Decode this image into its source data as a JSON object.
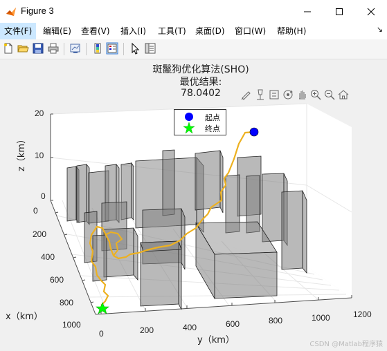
{
  "window": {
    "title": "Figure 3"
  },
  "menu": [
    {
      "label": "文件(F)"
    },
    {
      "label": "编辑(E)"
    },
    {
      "label": "查看(V)"
    },
    {
      "label": "插入(I)"
    },
    {
      "label": "工具(T)"
    },
    {
      "label": "桌面(D)"
    },
    {
      "label": "窗口(W)"
    },
    {
      "label": "帮助(H)"
    }
  ],
  "toolbar": {
    "icons": [
      "new-figure-icon",
      "open-file-icon",
      "save-icon",
      "print-icon",
      "link-plot-icon",
      "colorbar-icon",
      "legend-icon",
      "pointer-icon",
      "property-inspector-icon"
    ]
  },
  "axes_toolbar": {
    "icons": [
      "brush-icon",
      "data-tips-icon",
      "insert-colorbar-icon",
      "rotate-3d-icon",
      "pan-icon",
      "zoom-in-icon",
      "zoom-out-icon",
      "home-icon"
    ]
  },
  "figure": {
    "title_line1": "斑鬣狗优化算法(SHO)",
    "title_line2": "最优结果:",
    "title_line3": "78.0402",
    "legend": [
      {
        "label": "起点",
        "color": "#0000ff",
        "marker": "circle"
      },
      {
        "label": "终点",
        "color": "#00ff00",
        "marker": "star"
      }
    ],
    "xlabel": "x（km）",
    "ylabel": "y（km）",
    "zlabel": "z（km）",
    "x_ticks": [
      "0",
      "200",
      "400",
      "600",
      "800",
      "1000"
    ],
    "y_ticks": [
      "0",
      "200",
      "400",
      "600",
      "800",
      "1000",
      "1200"
    ],
    "z_ticks": [
      "0",
      "10",
      "20"
    ],
    "path_color": "#edb120",
    "box_color": "#808080"
  },
  "chart_data": {
    "type": "3d-line",
    "title": "斑鬣狗优化算法(SHO) 最优结果: 78.0402",
    "xlabel": "x（km）",
    "ylabel": "y（km）",
    "zlabel": "z（km）",
    "xlim": [
      0,
      1000
    ],
    "ylim": [
      0,
      1200
    ],
    "zlim": [
      0,
      20
    ],
    "series": [
      {
        "name": "起点",
        "x": [
          0
        ],
        "y": [
          1000
        ],
        "z": [
          20
        ]
      },
      {
        "name": "终点",
        "x": [
          1000
        ],
        "y": [
          0
        ],
        "z": [
          0
        ]
      }
    ]
  },
  "watermark": "CSDN @Matlab程序猿"
}
